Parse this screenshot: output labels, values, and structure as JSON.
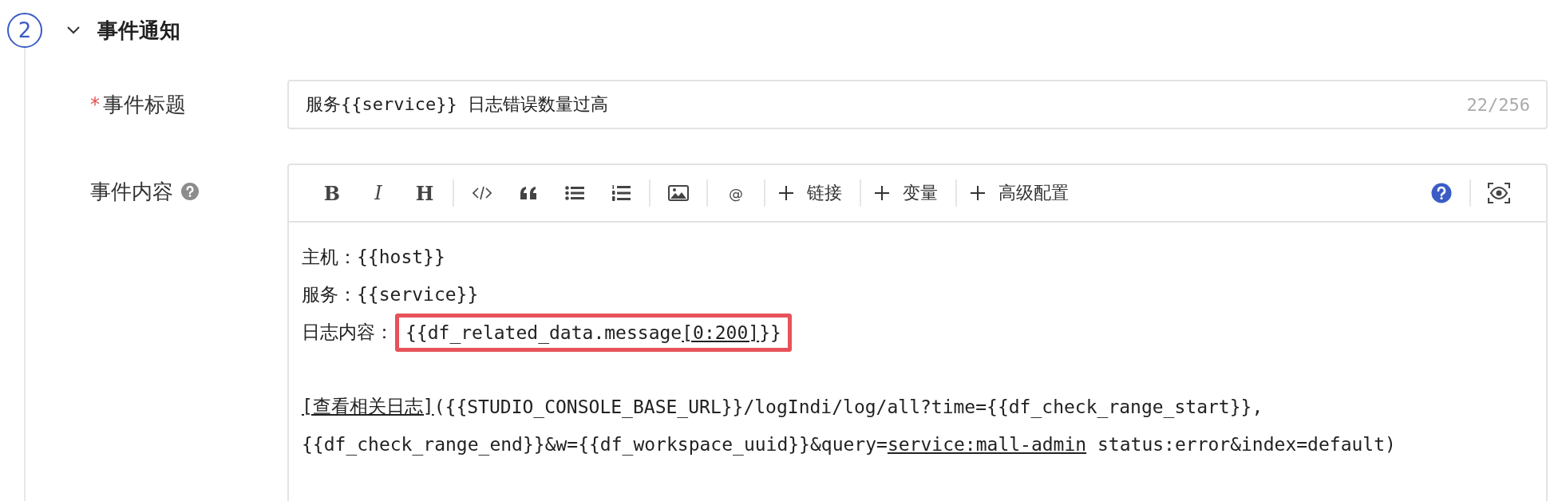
{
  "section": {
    "step": "2",
    "expanded": true,
    "title": "事件通知"
  },
  "title_field": {
    "label": "事件标题",
    "required_mark": "*",
    "value": "服务{{service}} 日志错误数量过高",
    "counter": "22/256"
  },
  "content_field": {
    "label": "事件内容",
    "help": true,
    "toolbar": {
      "groups": [
        [
          {
            "kind": "bold",
            "label": "B"
          },
          {
            "kind": "italic",
            "label": "I"
          },
          {
            "kind": "heading",
            "label": "H"
          }
        ],
        [
          {
            "kind": "code"
          },
          {
            "kind": "quote"
          },
          {
            "kind": "bullets"
          },
          {
            "kind": "numbering"
          }
        ],
        [
          {
            "kind": "image"
          }
        ],
        [
          {
            "kind": "mention",
            "label": "@"
          }
        ],
        [
          {
            "kind": "add",
            "label": "链接"
          }
        ],
        [
          {
            "kind": "add",
            "label": "变量"
          }
        ],
        [
          {
            "kind": "add",
            "label": "高级配置"
          }
        ]
      ],
      "right_groups": [
        [
          {
            "kind": "help"
          }
        ],
        [
          {
            "kind": "preview"
          }
        ]
      ]
    },
    "paragraphs": [
      [
        {
          "segments": [
            {
              "text": "主机：{{host}}",
              "underlined": false,
              "highlighted": false
            }
          ]
        },
        {
          "segments": [
            {
              "text": "服务：{{service}}",
              "underlined": false,
              "highlighted": false
            }
          ]
        },
        {
          "segments": [
            {
              "text": "日志内容：",
              "underlined": false,
              "highlighted": false
            },
            {
              "text": "{{df_related_data.message",
              "underlined": false,
              "highlighted": true
            },
            {
              "text": "[0:200]",
              "underlined": true,
              "highlighted": true
            },
            {
              "text": "}}",
              "underlined": false,
              "highlighted": true
            }
          ]
        }
      ],
      [
        {
          "segments": [
            {
              "text": "[查看相关日志]",
              "underlined": true,
              "highlighted": false
            },
            {
              "text": "({{STUDIO_CONSOLE_BASE_URL}}/logIndi/log/all?time={{df_check_range_start}},",
              "underlined": false,
              "highlighted": false
            }
          ]
        },
        {
          "segments": [
            {
              "text": "{{df_check_range_end}}&w={{df_workspace_uuid}}&query=",
              "underlined": false,
              "highlighted": false
            },
            {
              "text": "service:mall-admin",
              "underlined": true,
              "highlighted": false
            },
            {
              "text": " status:error&index=default)",
              "underlined": false,
              "highlighted": false
            }
          ]
        }
      ]
    ]
  }
}
